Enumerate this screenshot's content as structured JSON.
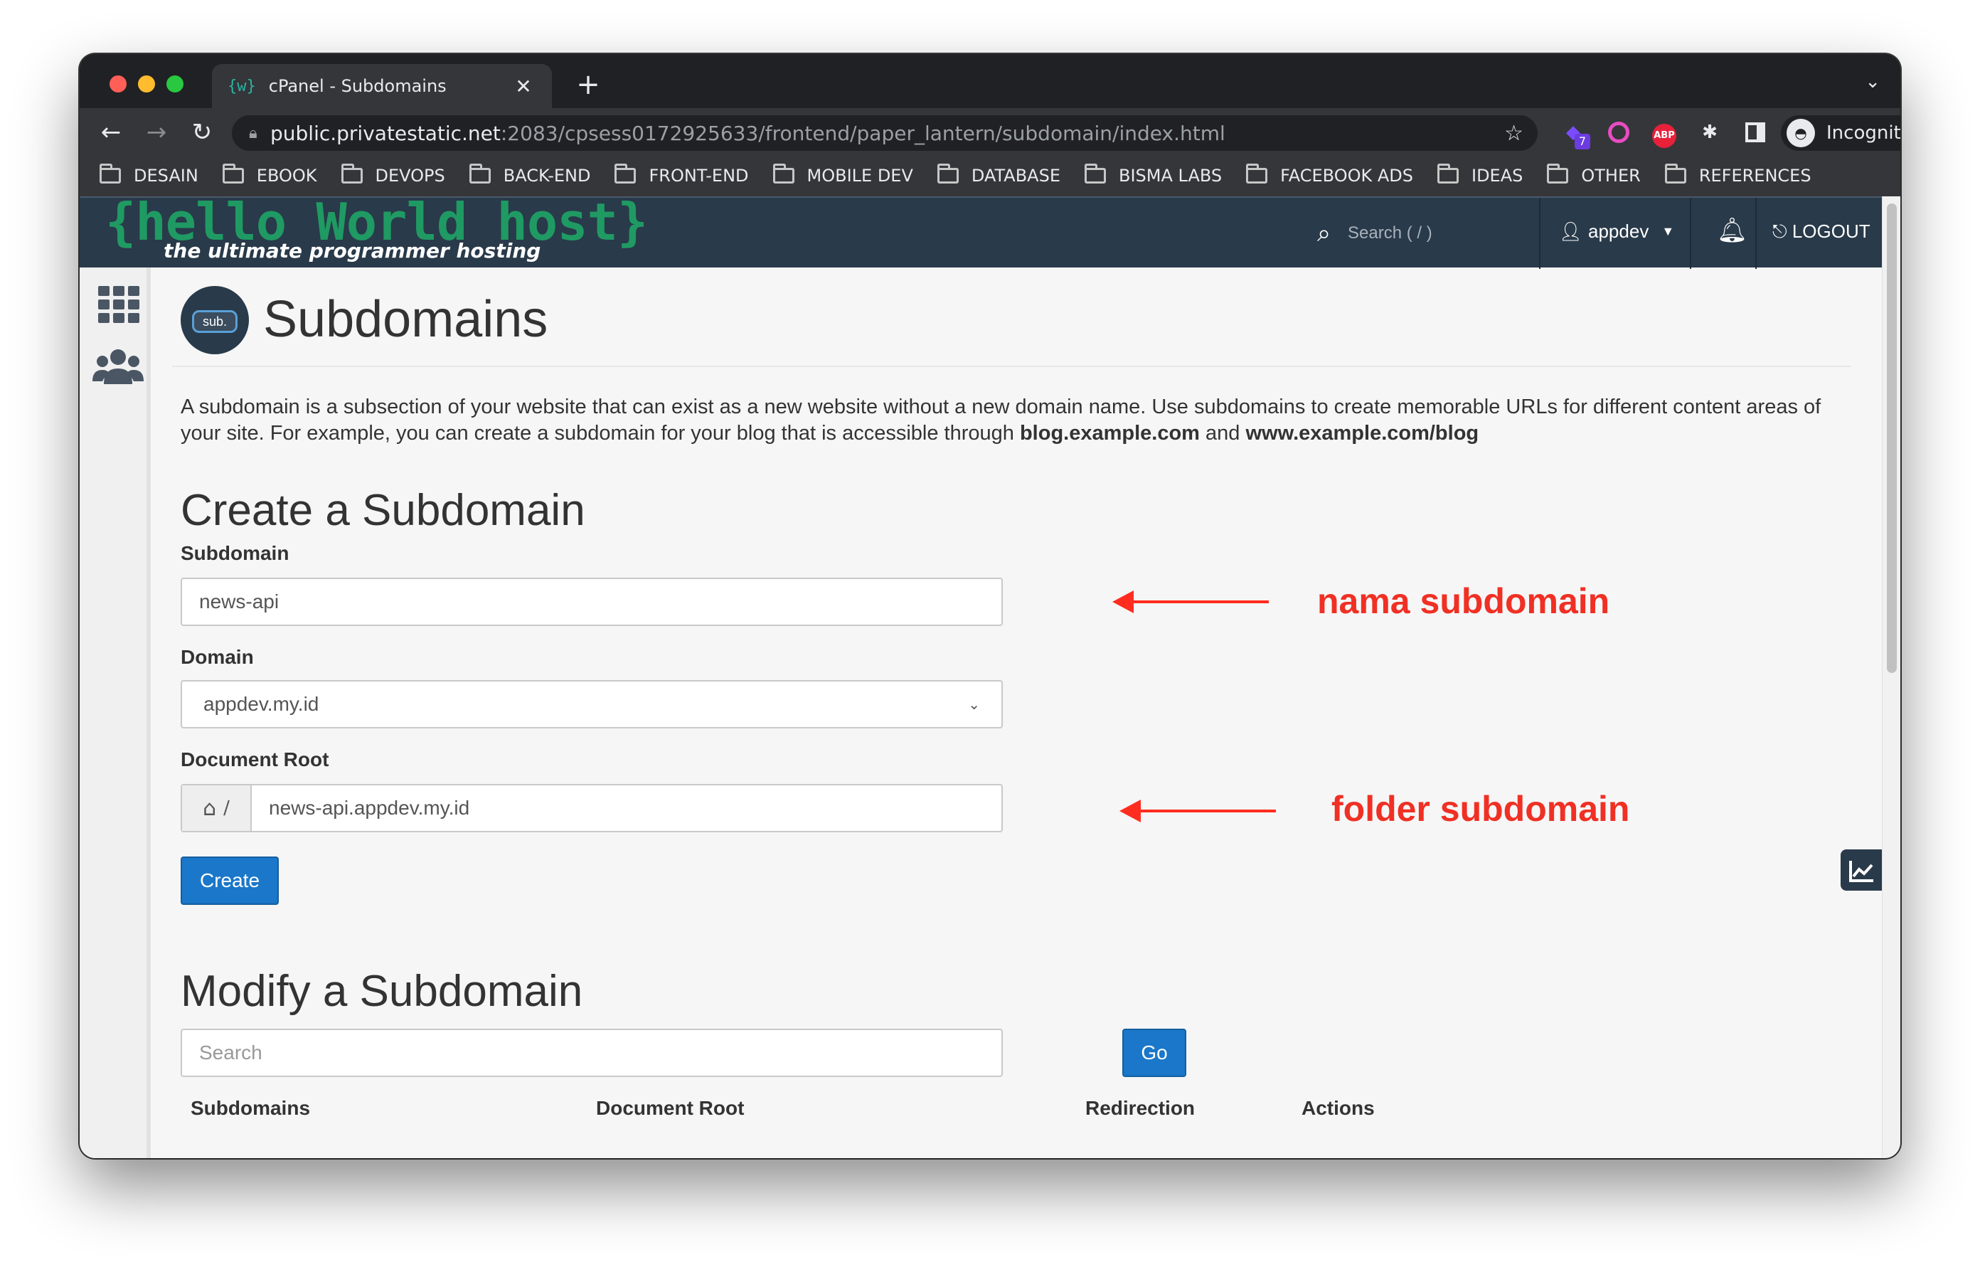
{
  "browser": {
    "tab_title": "cPanel - Subdomains",
    "tab_favicon": "{w}",
    "url_host": "public.privatestatic.net",
    "url_path": ":2083/cpsess0172925633/frontend/paper_lantern/subdomain/index.html",
    "extension_badge": "7",
    "abp_label": "ABP",
    "profile_label": "Incognito",
    "bookmarks": [
      "DESAIN",
      "EBOOK",
      "DEVOPS",
      "BACK-END",
      "FRONT-END",
      "MOBILE DEV",
      "DATABASE",
      "BISMA LABS",
      "FACEBOOK ADS",
      "IDEAS",
      "OTHER",
      "REFERENCES"
    ]
  },
  "header": {
    "logo_main": "{hello World host}",
    "logo_sub": "the ultimate programmer hosting",
    "search_placeholder": "Search ( / )",
    "user": "appdev",
    "logout": "LOGOUT"
  },
  "page": {
    "icon_label": "sub.",
    "title": "Subdomains",
    "intro_text": "A subdomain is a subsection of your website that can exist as a new website without a new domain name. Use subdomains to create memorable URLs for different content areas of your site. For example, you can create a subdomain for your blog that is accessible through ",
    "intro_link1": "blog.example.com",
    "intro_and": " and ",
    "intro_link2": "www.example.com/blog"
  },
  "create": {
    "title": "Create a Subdomain",
    "subdomain_label": "Subdomain",
    "subdomain_value": "news-api",
    "domain_label": "Domain",
    "domain_value": "appdev.my.id",
    "docroot_label": "Document Root",
    "docroot_prefix": "/",
    "docroot_value": "news-api.appdev.my.id",
    "create_button": "Create"
  },
  "modify": {
    "title": "Modify a Subdomain",
    "search_placeholder": "Search",
    "go_button": "Go",
    "columns": [
      "Subdomains",
      "Document Root",
      "Redirection",
      "Actions"
    ]
  },
  "annotations": {
    "subdomain_note": "nama subdomain",
    "folder_note": "folder subdomain",
    "color": "#f03024"
  },
  "colors": {
    "header_bg": "#293a4a",
    "primary_button": "#1a77c9",
    "logo_green": "#1f9a63"
  }
}
